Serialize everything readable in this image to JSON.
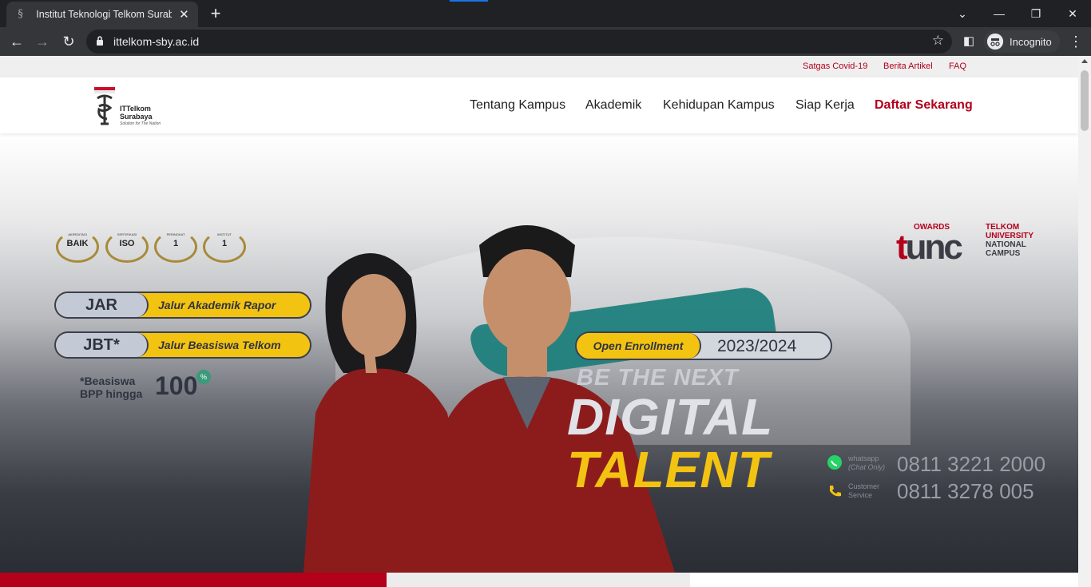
{
  "browser": {
    "tab_title": "Institut Teknologi Telkom Surabaya",
    "url": "ittelkom-sby.ac.id",
    "incognito_label": "Incognito"
  },
  "topbar": {
    "links": [
      "Satgas Covid-19",
      "Berita Artikel",
      "FAQ"
    ]
  },
  "logo": {
    "name_line1": "ITTelkom",
    "name_line2": "Surabaya",
    "tagline": "Solution for The Nation"
  },
  "nav": {
    "items": [
      "Tentang Kampus",
      "Akademik",
      "Kehidupan Kampus",
      "Siap Kerja"
    ],
    "cta": "Daftar Sekarang"
  },
  "hero": {
    "badges": [
      {
        "small": "AKREDITASI",
        "text": "BAIK"
      },
      {
        "small": "SERTIFIKASI",
        "text": "ISO"
      },
      {
        "small": "PERINGKAT",
        "text": "1"
      },
      {
        "small": "INSTITUT",
        "text": "1"
      }
    ],
    "programs": [
      {
        "code": "JAR",
        "label": "Jalur Akademik Rapor"
      },
      {
        "code": "JBT*",
        "label": "Jalur Beasiswa Telkom"
      }
    ],
    "scholarship": {
      "line1": "*Beasiswa",
      "line2": "BPP hingga",
      "amount": "100",
      "unit": "%"
    },
    "enrollment": {
      "label": "Open Enrollment",
      "year": "2023/2024"
    },
    "tagline": {
      "line1": "BE THE NEXT",
      "line2": "DIGITAL",
      "line3": "TALENT"
    },
    "tunc": {
      "owards": "OWARDS",
      "mark": "tunc",
      "line1": "TELKOM",
      "line2": "UNIVERSITY",
      "line3": "NATIONAL",
      "line4": "CAMPUS"
    },
    "contacts": [
      {
        "label1": "whatsapp",
        "label2": "(Chat Only)",
        "number": "0811 3221 2000",
        "icon": "whatsapp-icon"
      },
      {
        "label1": "Customer",
        "label2": "Service",
        "number": "0811 3278 005",
        "icon": "phone-icon"
      }
    ]
  },
  "colors": {
    "brand_red": "#b3001b",
    "accent_yellow": "#f3c312",
    "teal": "#167c79"
  }
}
